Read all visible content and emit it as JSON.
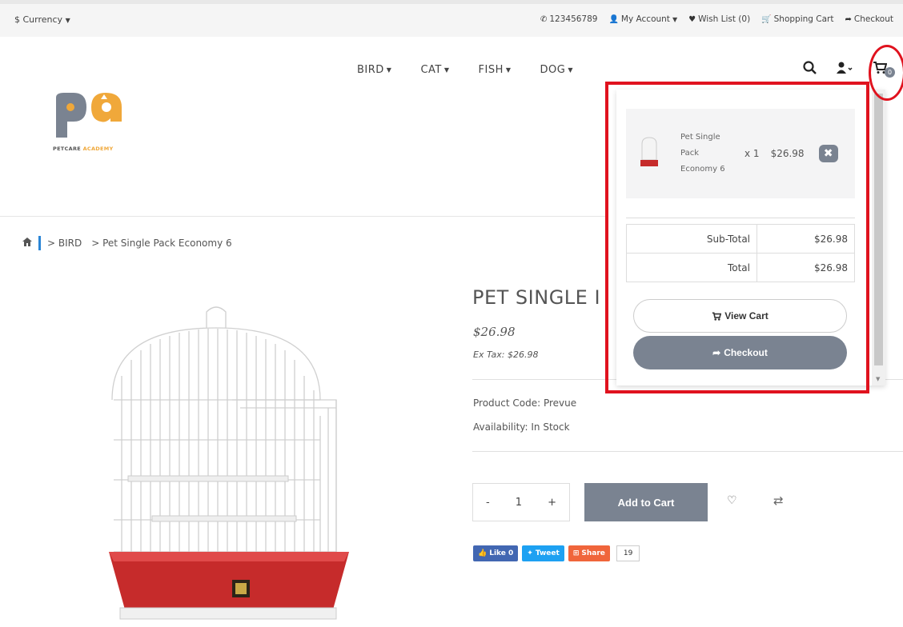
{
  "topbar": {
    "currency": "$ Currency",
    "phone": "123456789",
    "account": "My Account",
    "wishlist": "Wish List (0)",
    "cart": "Shopping Cart",
    "checkout": "Checkout"
  },
  "nav": {
    "items": [
      "BIRD",
      "CAT",
      "FISH",
      "DOG"
    ]
  },
  "header": {
    "cart_count": "0"
  },
  "logo": {
    "letters": "pa",
    "text_1": "PETCARE",
    "text_2": "ACADEMY"
  },
  "breadcrumb": {
    "item_1": "> BIRD",
    "item_2": "> Pet Single Pack Economy 6"
  },
  "product": {
    "title": "PET SINGLE I",
    "price": "$26.98",
    "ex_tax": "Ex Tax: $26.98",
    "code": "Product Code: Prevue",
    "availability": "Availability: In Stock",
    "qty_minus": "-",
    "qty_value": "1",
    "qty_plus": "+",
    "add_to_cart": "Add to Cart"
  },
  "social": {
    "like": "Like 0",
    "tweet": "Tweet",
    "share": "Share",
    "share_count": "19"
  },
  "cart_dropdown": {
    "item": {
      "name": "Pet Single Pack Economy 6",
      "qty": "x 1",
      "price": "$26.98"
    },
    "subtotal_label": "Sub-Total",
    "subtotal_value": "$26.98",
    "total_label": "Total",
    "total_value": "$26.98",
    "view_cart": "View Cart",
    "checkout": "Checkout"
  },
  "colors": {
    "accent": "#7a8391",
    "annotation_red": "#e0121e",
    "breadcrumb_bar": "#2a85d6"
  }
}
